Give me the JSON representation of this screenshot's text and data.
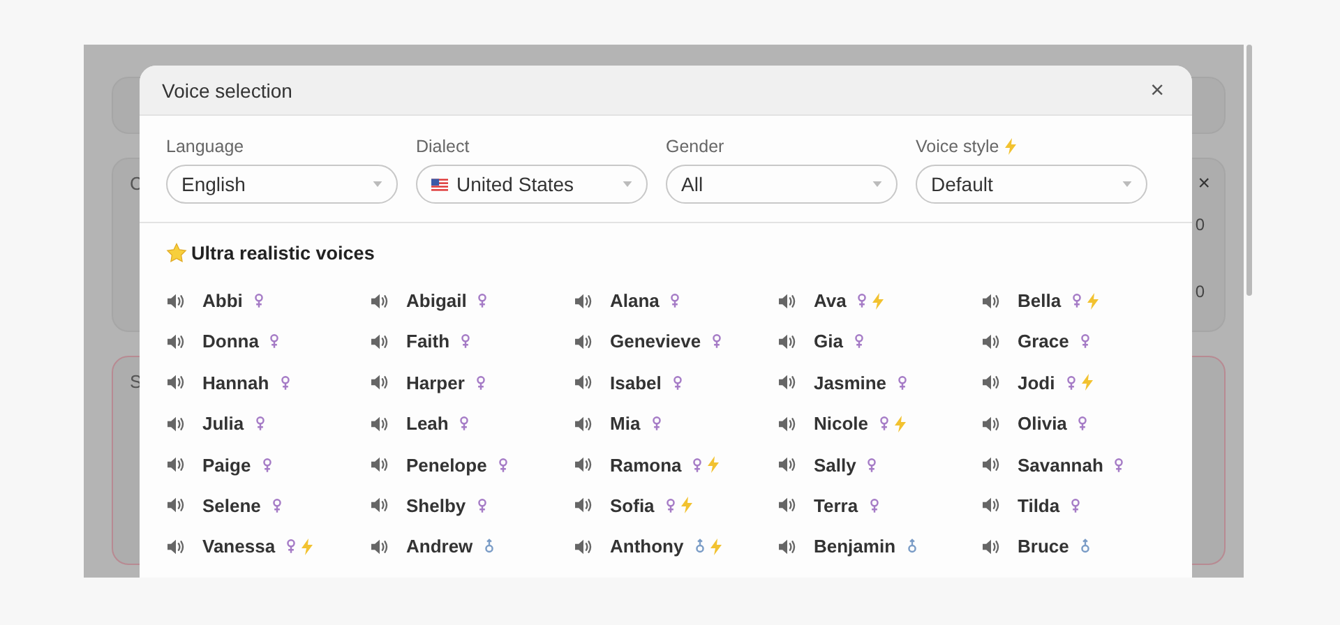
{
  "background": {
    "cards": [
      {
        "kind": "bar"
      },
      {
        "kind": "panel",
        "label": "C",
        "close": "×",
        "readings": [
          "0",
          "0"
        ]
      },
      {
        "kind": "alert",
        "label": "S"
      }
    ]
  },
  "dialog": {
    "title": "Voice selection",
    "close": "×",
    "filters": [
      {
        "kind": "plain",
        "label": "Language",
        "value": "English",
        "premium": false
      },
      {
        "kind": "country",
        "label": "Dialect",
        "value": "United States",
        "premium": false
      },
      {
        "kind": "plain",
        "label": "Gender",
        "value": "All",
        "premium": false
      },
      {
        "kind": "plain",
        "label": "Voice style",
        "value": "Default",
        "premium": true
      }
    ],
    "section": {
      "title": "Ultra realistic voices",
      "voices": [
        {
          "kind": "female",
          "name": "Abbi",
          "premium": false
        },
        {
          "kind": "female",
          "name": "Abigail",
          "premium": false
        },
        {
          "kind": "female",
          "name": "Alana",
          "premium": false
        },
        {
          "kind": "female",
          "name": "Ava",
          "premium": true
        },
        {
          "kind": "female",
          "name": "Bella",
          "premium": true
        },
        {
          "kind": "female",
          "name": "Donna",
          "premium": false
        },
        {
          "kind": "female",
          "name": "Faith",
          "premium": false
        },
        {
          "kind": "female",
          "name": "Genevieve",
          "premium": false
        },
        {
          "kind": "female",
          "name": "Gia",
          "premium": false
        },
        {
          "kind": "female",
          "name": "Grace",
          "premium": false
        },
        {
          "kind": "female",
          "name": "Hannah",
          "premium": false
        },
        {
          "kind": "female",
          "name": "Harper",
          "premium": false
        },
        {
          "kind": "female",
          "name": "Isabel",
          "premium": false
        },
        {
          "kind": "female",
          "name": "Jasmine",
          "premium": false
        },
        {
          "kind": "female",
          "name": "Jodi",
          "premium": true
        },
        {
          "kind": "female",
          "name": "Julia",
          "premium": false
        },
        {
          "kind": "female",
          "name": "Leah",
          "premium": false
        },
        {
          "kind": "female",
          "name": "Mia",
          "premium": false
        },
        {
          "kind": "female",
          "name": "Nicole",
          "premium": true
        },
        {
          "kind": "female",
          "name": "Olivia",
          "premium": false
        },
        {
          "kind": "female",
          "name": "Paige",
          "premium": false
        },
        {
          "kind": "female",
          "name": "Penelope",
          "premium": false
        },
        {
          "kind": "female",
          "name": "Ramona",
          "premium": true
        },
        {
          "kind": "female",
          "name": "Sally",
          "premium": false
        },
        {
          "kind": "female",
          "name": "Savannah",
          "premium": false
        },
        {
          "kind": "female",
          "name": "Selene",
          "premium": false
        },
        {
          "kind": "female",
          "name": "Shelby",
          "premium": false
        },
        {
          "kind": "female",
          "name": "Sofia",
          "premium": true
        },
        {
          "kind": "female",
          "name": "Terra",
          "premium": false
        },
        {
          "kind": "female",
          "name": "Tilda",
          "premium": false
        },
        {
          "kind": "female",
          "name": "Vanessa",
          "premium": true
        },
        {
          "kind": "male",
          "name": "Andrew",
          "premium": false
        },
        {
          "kind": "male",
          "name": "Anthony",
          "premium": true
        },
        {
          "kind": "male",
          "name": "Benjamin",
          "premium": false
        },
        {
          "kind": "male",
          "name": "Bruce",
          "premium": false
        }
      ]
    }
  }
}
